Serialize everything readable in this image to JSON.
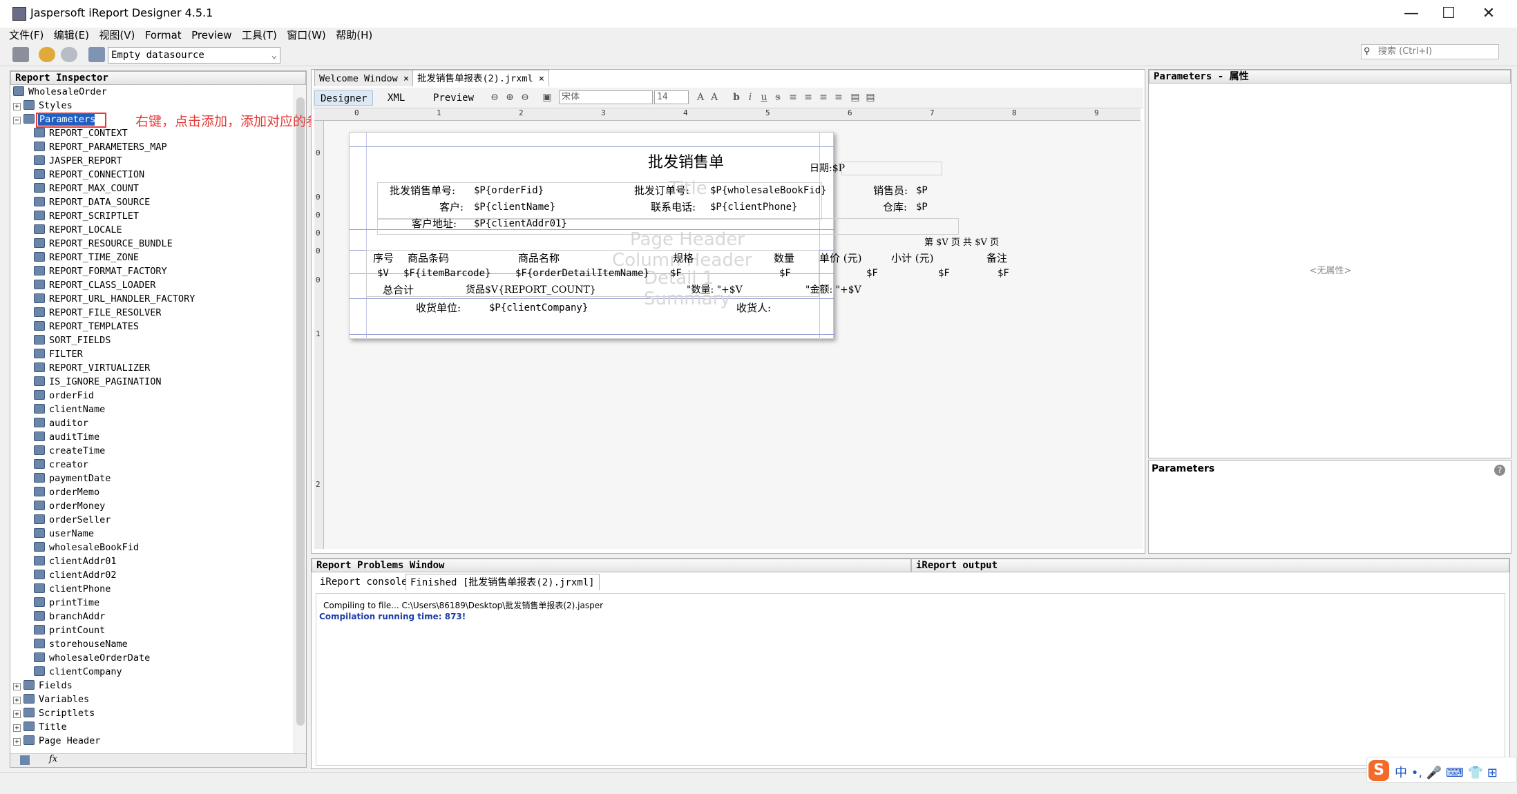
{
  "window": {
    "title": "Jaspersoft iReport Designer 4.5.1",
    "min": "—",
    "max": "☐",
    "close": "✕"
  },
  "menu": [
    "文件(F)",
    "编辑(E)",
    "视图(V)",
    "Format",
    "Preview",
    "工具(T)",
    "窗口(W)",
    "帮助(H)"
  ],
  "toolbar": {
    "datasource": "Empty datasource",
    "search_placeholder": "搜索 (Ctrl+I)"
  },
  "inspector": {
    "title": "Report Inspector",
    "root": "WholesaleOrder",
    "styles": "Styles",
    "parameters": "Parameters",
    "params": [
      "REPORT_CONTEXT",
      "REPORT_PARAMETERS_MAP",
      "JASPER_REPORT",
      "REPORT_CONNECTION",
      "REPORT_MAX_COUNT",
      "REPORT_DATA_SOURCE",
      "REPORT_SCRIPTLET",
      "REPORT_LOCALE",
      "REPORT_RESOURCE_BUNDLE",
      "REPORT_TIME_ZONE",
      "REPORT_FORMAT_FACTORY",
      "REPORT_CLASS_LOADER",
      "REPORT_URL_HANDLER_FACTORY",
      "REPORT_FILE_RESOLVER",
      "REPORT_TEMPLATES",
      "SORT_FIELDS",
      "FILTER",
      "REPORT_VIRTUALIZER",
      "IS_IGNORE_PAGINATION",
      "orderFid",
      "clientName",
      "auditor",
      "auditTime",
      "createTime",
      "creator",
      "paymentDate",
      "orderMemo",
      "orderMoney",
      "orderSeller",
      "userName",
      "wholesaleBookFid",
      "clientAddr01",
      "clientAddr02",
      "clientPhone",
      "printTime",
      "branchAddr",
      "printCount",
      "storehouseName",
      "wholesaleOrderDate",
      "clientCompany"
    ],
    "sections": [
      "Fields",
      "Variables",
      "Scriptlets",
      "Title",
      "Page Header"
    ]
  },
  "annotation": "右键，点击添加，添加对应的参数",
  "editor": {
    "tabs": [
      "Welcome Window",
      "批发销售单报表(2).jrxml"
    ],
    "subtabs": [
      "Designer",
      "XML",
      "Preview"
    ],
    "font": "宋体",
    "size": "14",
    "ruler": [
      "0",
      "1",
      "2",
      "3",
      "4",
      "5",
      "6",
      "7",
      "8",
      "9"
    ],
    "vruler": [
      "0",
      "0",
      "0",
      "0",
      "0",
      "0",
      "1",
      "2"
    ]
  },
  "report": {
    "title": "批发销售单",
    "date_label": "日期:$P",
    "band_title": "Title",
    "band_page_header": "Page Header",
    "band_column_header": "Column Header",
    "band_detail": "Detail 1",
    "band_summary": "Summary",
    "orderno_label": "批发销售单号:",
    "orderno": "$P{orderFid}",
    "bookno_label": "批发订单号:",
    "bookno": "$P{wholesaleBookFid}",
    "seller_label": "销售员:",
    "seller": "$P",
    "client_label": "客户:",
    "client": "$P{clientName}",
    "phone_label": "联系电话:",
    "phone": "$P{clientPhone}",
    "store_label": "仓库:",
    "store": "$P",
    "addr_label": "客户地址:",
    "addr": "$P{clientAddr01}",
    "page_no": "第 $V 页  共 $V 页",
    "cols": [
      "序号",
      "商品条码",
      "商品名称",
      "规格",
      "数量",
      "单价 (元)",
      "小计 (元)",
      "备注"
    ],
    "row": [
      "$V",
      "$F{itemBarcode}",
      "$F{orderDetailItemName}",
      "$F",
      "$F",
      "$F",
      "$F",
      "$F"
    ],
    "total_label": "总合计",
    "total_goods": "货品$V{REPORT_COUNT}",
    "total_qty": "\"数量: \"+$V",
    "total_amt": "\"金额: \"+$V",
    "receiver_unit_label": "收货单位:",
    "receiver_unit": "$P{clientCompany}",
    "receiver_label": "收货人:"
  },
  "props": {
    "title": "Parameters - 属性",
    "empty": "<无属性>",
    "help_title": "Parameters"
  },
  "output": {
    "title": "Report Problems Window",
    "title2": "iReport output",
    "tabs": [
      "iReport console",
      "Finished [批发销售单报表(2).jrxml]"
    ],
    "line1": "Compiling to file... C:\\Users\\86189\\Desktop\\批发销售单报表(2).jasper",
    "line2": "Compilation running time: 873!"
  },
  "ime": {
    "logo": "S",
    "text": "中 •, 🎤 ⌨ 👕 ⊞"
  }
}
